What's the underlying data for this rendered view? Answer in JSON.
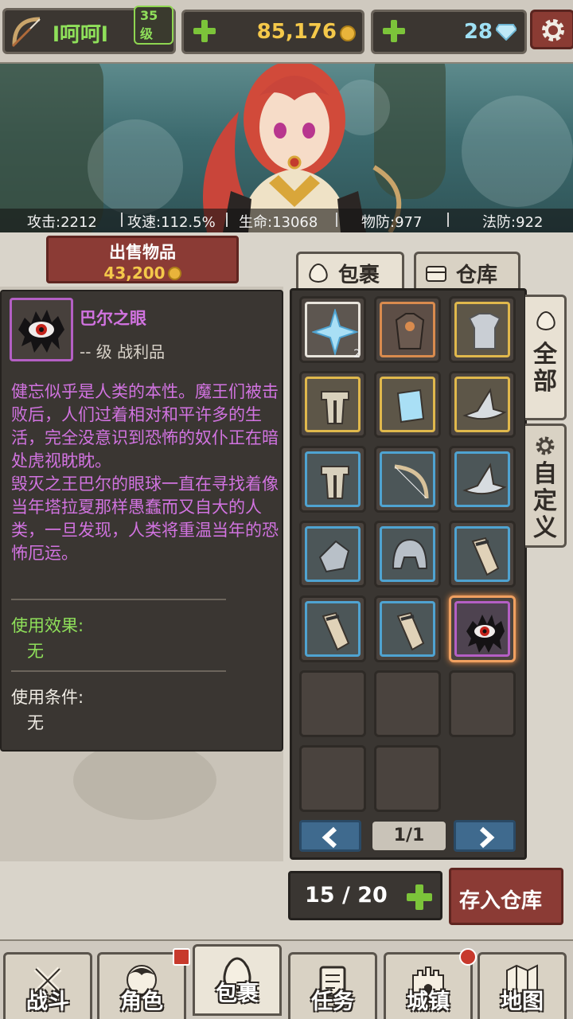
{
  "player": {
    "name": "l呵呵l",
    "level": "35 级"
  },
  "currencies": {
    "gold": "85,176",
    "gems": "28"
  },
  "stats": [
    {
      "label": "攻击:2212"
    },
    {
      "label": "攻速:112.5%"
    },
    {
      "label": "生命:13068"
    },
    {
      "label": "物防:977"
    },
    {
      "label": "法防:922"
    }
  ],
  "sell": {
    "title": "出售物品",
    "price": "43,200"
  },
  "item": {
    "name": "巴尔之眼",
    "level": "-- 级 战利品",
    "description": "健忘似乎是人类的本性。魔王们被击败后，人们过着相对和平许多的生活，完全没意识到恐怖的奴仆正在暗处虎视眈眈。\n毁灭之王巴尔的眼球一直在寻找着像当年塔拉夏那样愚蠢而又自大的人类，一旦发现，人类将重温当年的恐怖厄运。",
    "effect_label": "使用效果:",
    "effect_value": "无",
    "condition_label": "使用条件:",
    "condition_value": "无",
    "name_color": "#d173e0",
    "effect_color": "#8fe05a"
  },
  "tabs": {
    "bag": "包裹",
    "storage": "仓库"
  },
  "filters": {
    "all": "全部",
    "custom": "自定义"
  },
  "inventory": [
    {
      "icon": "crystal-icon",
      "rarity": "white",
      "count": "2"
    },
    {
      "icon": "armor-icon",
      "rarity": "orange"
    },
    {
      "icon": "chestplate-icon",
      "rarity": "gold"
    },
    {
      "icon": "greaves-icon",
      "rarity": "gold"
    },
    {
      "icon": "scroll-icon",
      "rarity": "gold"
    },
    {
      "icon": "hat-icon",
      "rarity": "gold"
    },
    {
      "icon": "greaves-icon",
      "rarity": "blue"
    },
    {
      "icon": "bow-icon",
      "rarity": "blue"
    },
    {
      "icon": "hat-icon",
      "rarity": "blue"
    },
    {
      "icon": "gauntlet-icon",
      "rarity": "blue"
    },
    {
      "icon": "helmet-icon",
      "rarity": "blue"
    },
    {
      "icon": "bracer-icon",
      "rarity": "blue"
    },
    {
      "icon": "bracer-icon",
      "rarity": "blue"
    },
    {
      "icon": "bracer-icon",
      "rarity": "blue"
    },
    {
      "icon": "eye-icon",
      "rarity": "purple",
      "selected": true
    }
  ],
  "pager": {
    "label": "1/1"
  },
  "capacity": {
    "label": "15 / 20"
  },
  "store_button": "存入仓库",
  "nav": [
    {
      "label": "战斗",
      "icon": "swords-icon"
    },
    {
      "label": "角色",
      "icon": "character-icon"
    },
    {
      "label": "包裹",
      "icon": "bag-icon"
    },
    {
      "label": "任务",
      "icon": "quest-icon"
    },
    {
      "label": "城镇",
      "icon": "castle-icon"
    },
    {
      "label": "地图",
      "icon": "map-icon"
    }
  ]
}
